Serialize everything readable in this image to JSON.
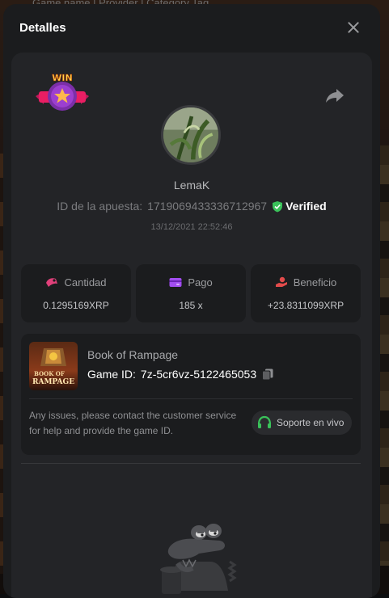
{
  "background": {
    "top_text": "Game name | Provider | Category Tag"
  },
  "modal": {
    "title": "Detalles",
    "close_icon": "close-icon"
  },
  "badge": {
    "text": "WIN",
    "icon": "win-star-badge"
  },
  "share": {
    "icon": "share-icon"
  },
  "user": {
    "avatar_icon": "plant-avatar",
    "name": "LemaK",
    "bet_id_label": "ID de la apuesta:",
    "bet_id": "1719069433336712967",
    "verified_label": "Verified",
    "verified_icon": "shield-check-icon",
    "date": "13/12/2021 22:52:46"
  },
  "stats": [
    {
      "label": "Cantidad",
      "value": "0.1295169XRP",
      "icon": "bet-amount-icon",
      "color": "#e0407a"
    },
    {
      "label": "Pago",
      "value": "185 x",
      "icon": "card-icon",
      "color": "#a24df0"
    },
    {
      "label": "Beneficio",
      "value": "+23.8311099XRP",
      "icon": "profit-hand-icon",
      "color": "#e24b4b"
    }
  ],
  "game": {
    "name": "Book of Rampage",
    "game_id_label": "Game ID:",
    "game_id": "7z-5cr6vz-5122465053",
    "thumb_text_line1": "BOOK OF",
    "thumb_text_line2": "RAMPAGE",
    "help_text": "Any issues, please contact the customer service for help and provide the game ID.",
    "support_label": "Soporte en vivo",
    "support_icon": "headset-icon",
    "copy_icon": "copy-icon"
  },
  "colors": {
    "accent_green": "#3ac25a",
    "modal_bg": "#1b1c1e",
    "panel_bg": "#232427"
  }
}
